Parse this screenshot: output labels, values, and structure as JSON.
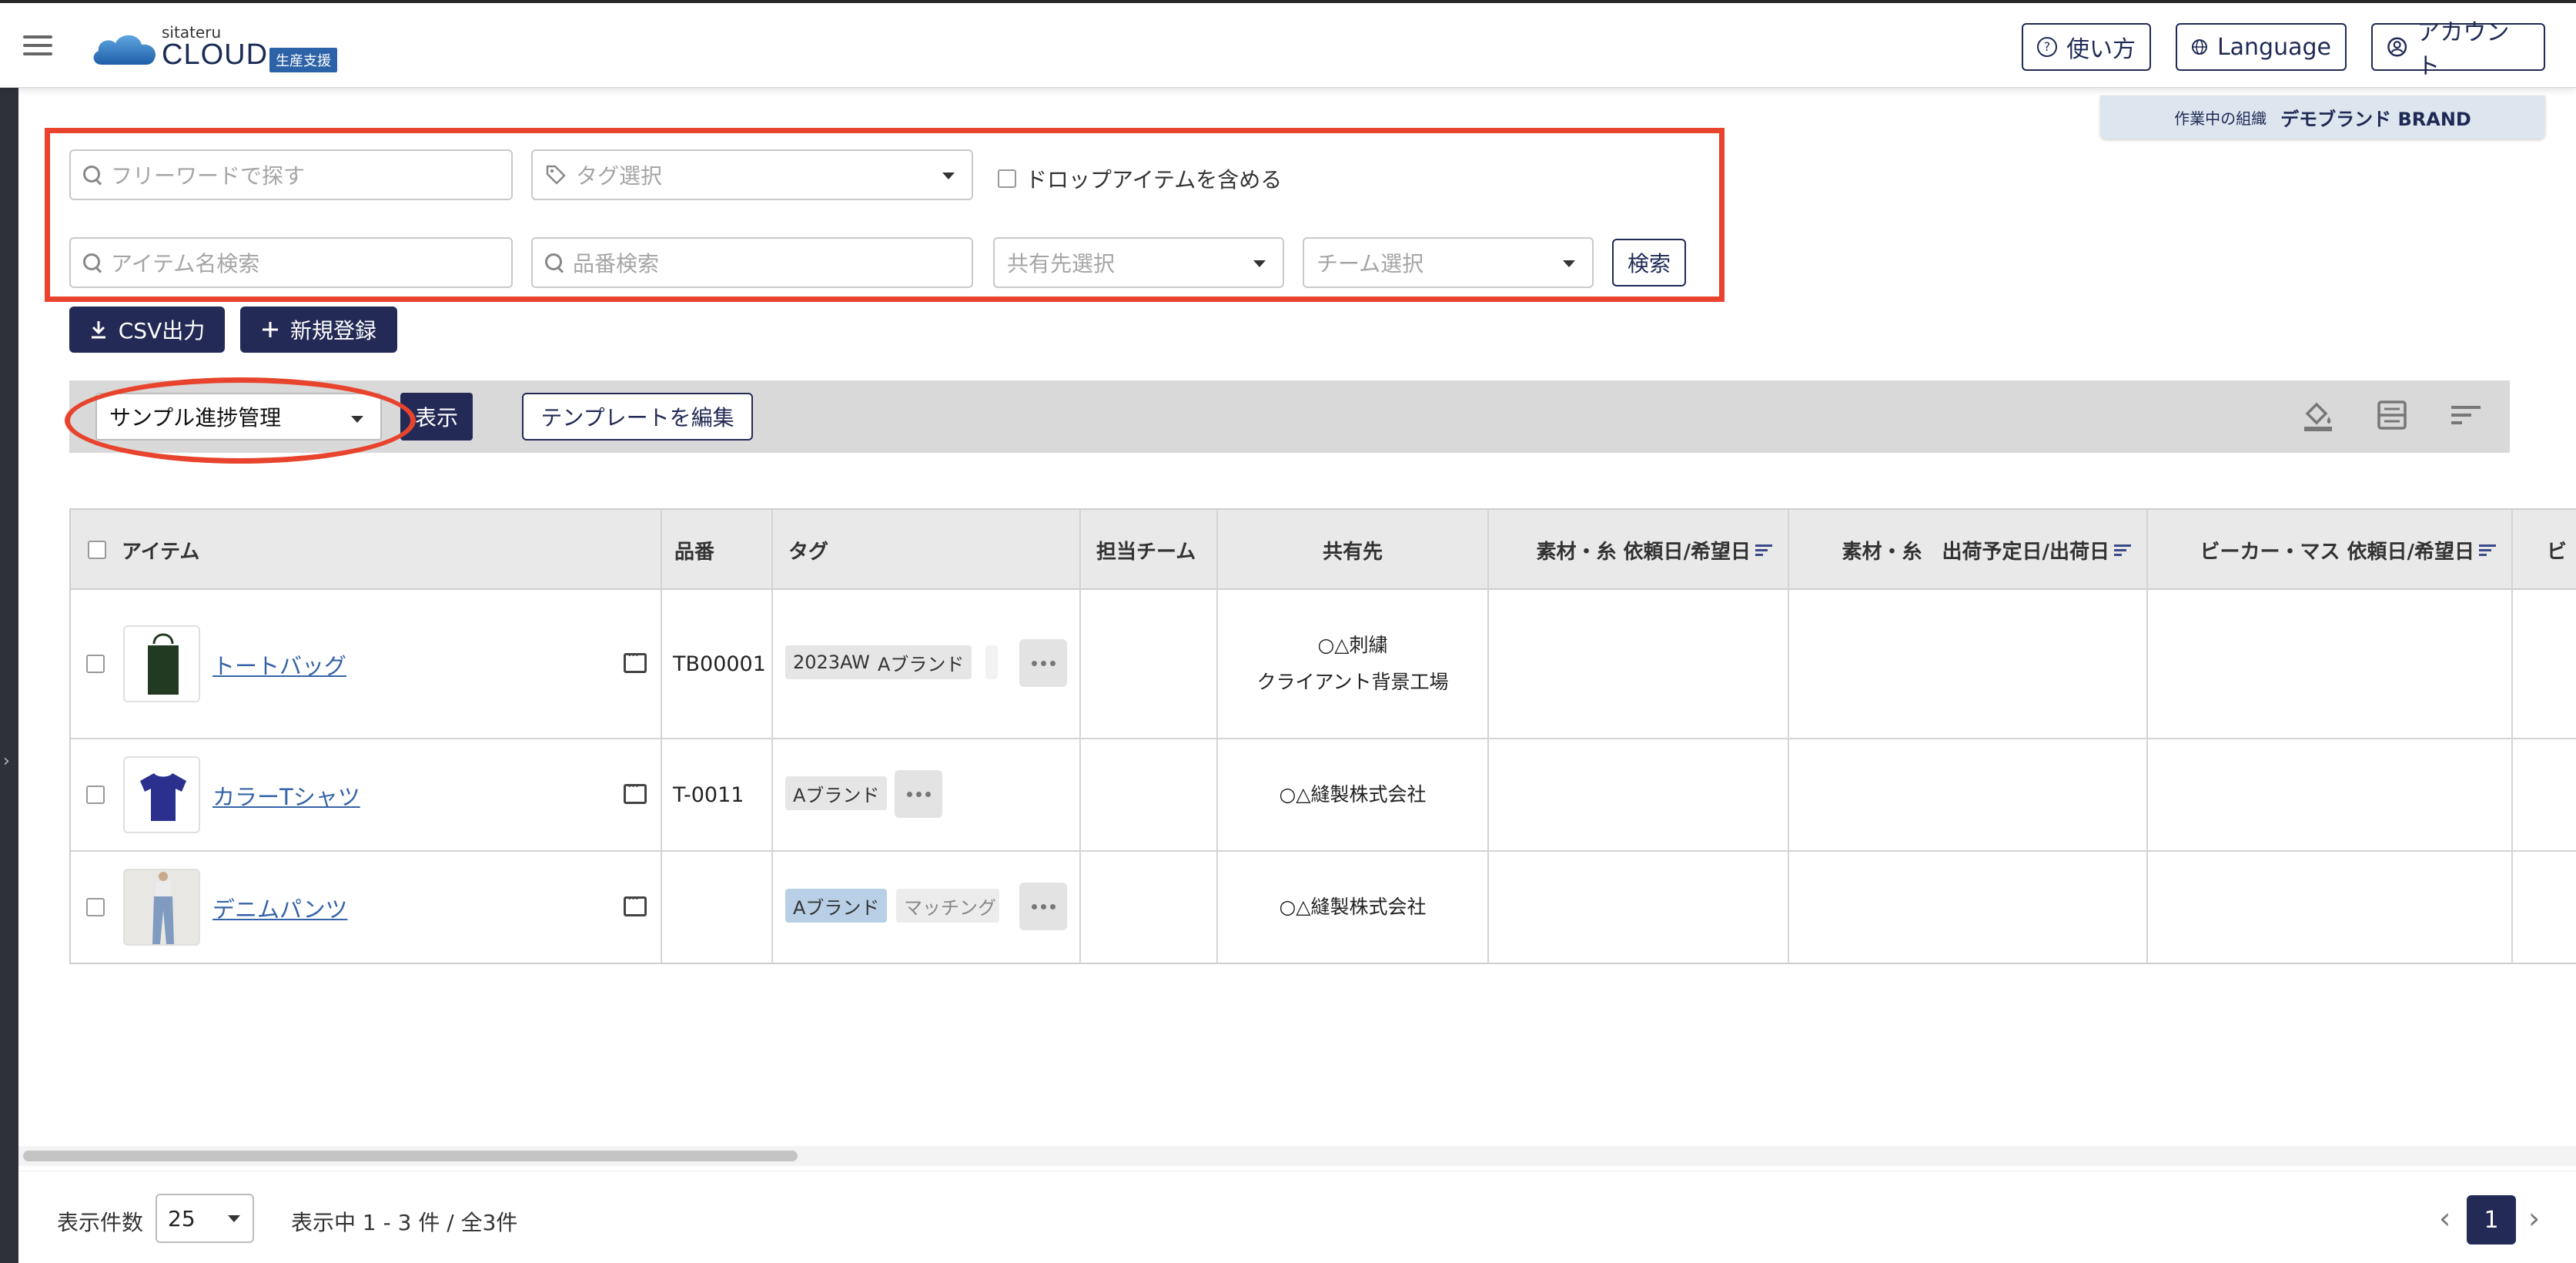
{
  "header": {
    "logo_small": "sitateru",
    "logo_main": "CLOUD",
    "logo_badge": "生産支援",
    "help_label": "使い方",
    "language_label": "Language",
    "account_label": "アカウント"
  },
  "org": {
    "label": "作業中の組織",
    "name": "デモブランド BRAND"
  },
  "search": {
    "freeword_placeholder": "フリーワードで探す",
    "tag_placeholder": "タグ選択",
    "include_drop_label": "ドロップアイテムを含める",
    "item_name_placeholder": "アイテム名検索",
    "part_number_placeholder": "品番検索",
    "share_placeholder": "共有先選択",
    "team_placeholder": "チーム選択",
    "search_button": "検索"
  },
  "actions": {
    "csv_label": "CSV出力",
    "new_label": "新規登録"
  },
  "toolbar": {
    "view_selected": "サンプル進捗管理",
    "show_label": "表示",
    "template_label": "テンプレートを編集",
    "icons": [
      "paint-bucket-icon",
      "layout-icon",
      "sort-icon"
    ]
  },
  "table": {
    "columns": [
      "アイテム",
      "品番",
      "タグ",
      "担当チーム",
      "共有先",
      "素材・糸 依頼日/希望日",
      "素材・糸　出荷予定日/出荷日",
      "ビーカー・マス 依頼日/希望日",
      "ビ"
    ],
    "rows": [
      {
        "name": "トートバッグ",
        "part_number": "TB00001",
        "tags": [
          "2023AW",
          "Aブランド"
        ],
        "share": [
          "○△刺繍",
          "クライアント背景工場"
        ],
        "thumb_color": "#233a22"
      },
      {
        "name": "カラーTシャツ",
        "part_number": "T-0011",
        "tags": [
          "Aブランド"
        ],
        "share": [
          "○△縫製株式会社"
        ],
        "thumb_color": "#2b2f8e"
      },
      {
        "name": "デニムパンツ",
        "part_number": "",
        "tags": [
          "Aブランド",
          "マッチング"
        ],
        "share": [
          "○△縫製株式会社"
        ],
        "thumb_color": "#7f9bbf"
      }
    ]
  },
  "footer": {
    "per_page_label": "表示件数",
    "per_page_value": "25",
    "range_text": "表示中 1 - 3 件 / 全3件",
    "current_page": "1"
  },
  "colors": {
    "navy": "#232a55",
    "annotation": "#e8432c",
    "link": "#3563a8"
  }
}
